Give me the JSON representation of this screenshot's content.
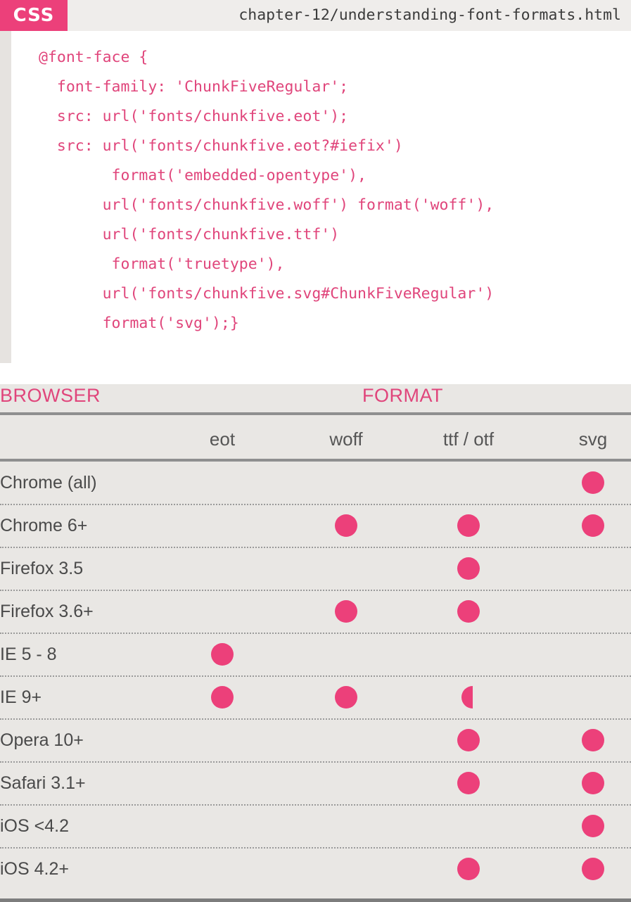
{
  "code": {
    "badge": "CSS",
    "file": "chapter-12/understanding-font-formats.html",
    "lines": [
      "@font-face {",
      "  font-family: 'ChunkFiveRegular';",
      "  src: url('fonts/chunkfive.eot');",
      "  src: url('fonts/chunkfive.eot?#iefix')",
      "        format('embedded-opentype'),",
      "       url('fonts/chunkfive.woff') format('woff'),",
      "       url('fonts/chunkfive.ttf')",
      "        format('truetype'),",
      "       url('fonts/chunkfive.svg#ChunkFiveRegular')",
      "       format('svg');}"
    ]
  },
  "table": {
    "browser_label": "BROWSER",
    "format_label": "FORMAT",
    "columns": [
      "eot",
      "woff",
      "ttf / otf",
      "svg"
    ],
    "accent_color": "#ec407a",
    "rows": [
      {
        "browser": "Chrome (all)",
        "support": [
          "none",
          "none",
          "none",
          "full"
        ]
      },
      {
        "browser": "Chrome 6+",
        "support": [
          "none",
          "full",
          "full",
          "full"
        ]
      },
      {
        "browser": "Firefox 3.5",
        "support": [
          "none",
          "none",
          "full",
          "none"
        ]
      },
      {
        "browser": "Firefox 3.6+",
        "support": [
          "none",
          "full",
          "full",
          "none"
        ]
      },
      {
        "browser": "IE 5 - 8",
        "support": [
          "full",
          "none",
          "none",
          "none"
        ]
      },
      {
        "browser": "IE 9+",
        "support": [
          "full",
          "full",
          "partial",
          "none"
        ]
      },
      {
        "browser": "Opera 10+",
        "support": [
          "none",
          "none",
          "full",
          "full"
        ]
      },
      {
        "browser": "Safari 3.1+",
        "support": [
          "none",
          "none",
          "full",
          "full"
        ]
      },
      {
        "browser": "iOS <4.2",
        "support": [
          "none",
          "none",
          "none",
          "full"
        ]
      },
      {
        "browser": "iOS 4.2+",
        "support": [
          "none",
          "none",
          "full",
          "full"
        ]
      }
    ]
  }
}
